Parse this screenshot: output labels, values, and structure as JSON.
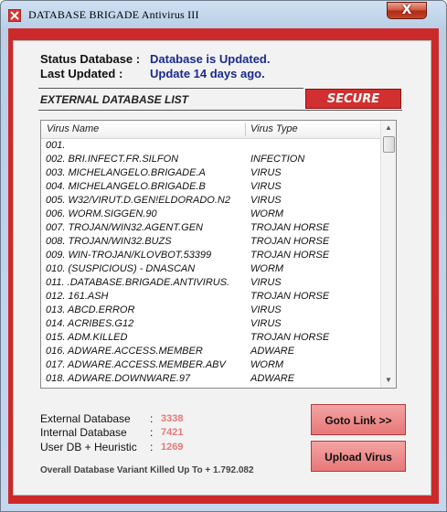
{
  "window": {
    "title": "DATABASE BRIGADE Antivirus III",
    "close_label": "X",
    "colors": {
      "frame": "#cc2a2a",
      "status_value": "#1a2a8c",
      "stat_value": "#e87878",
      "secure_bg": "#d23030"
    }
  },
  "status": {
    "database_label": "Status Database  :",
    "database_value": "Database is Updated.",
    "updated_label": "Last Updated      :",
    "updated_value": "Update 14 days ago."
  },
  "list": {
    "heading": "EXTERNAL DATABASE LIST",
    "secure_label": "SECURE",
    "columns": [
      "Virus Name",
      "Virus Type"
    ],
    "rows": [
      [
        "001.",
        ""
      ],
      [
        "002.  BRI.INFECT.FR.SILFON",
        "INFECTION"
      ],
      [
        "003.  MICHELANGELO.BRIGADE.A",
        "VIRUS"
      ],
      [
        "004.  MICHELANGELO.BRIGADE.B",
        "VIRUS"
      ],
      [
        "005.  W32/VIRUT.D.GEN!ELDORADO.N2",
        "VIRUS"
      ],
      [
        "006.  WORM.SIGGEN.90",
        "WORM"
      ],
      [
        "007. TROJAN/WIN32.AGENT.GEN",
        "TROJAN HORSE"
      ],
      [
        "008. TROJAN/WIN32.BUZS",
        "TROJAN HORSE"
      ],
      [
        "009. WIN-TROJAN/KLOVBOT.53399",
        "TROJAN HORSE"
      ],
      [
        "010. (SUSPICIOUS) - DNASCAN",
        "WORM"
      ],
      [
        "011. .DATABASE.BRIGADE.ANTIVIRUS.",
        "VIRUS"
      ],
      [
        "012. 161.ASH",
        "TROJAN HORSE"
      ],
      [
        "013. ABCD.ERROR",
        "VIRUS"
      ],
      [
        "014. ACRIBES.G12",
        "VIRUS"
      ],
      [
        "015. ADM.KILLED",
        "TROJAN HORSE"
      ],
      [
        "016. ADWARE.ACCESS.MEMBER",
        "ADWARE"
      ],
      [
        "017. ADWARE.ACCESS.MEMBER.ABV",
        "WORM"
      ],
      [
        "018. ADWARE.DOWNWARE.97",
        "ADWARE"
      ]
    ]
  },
  "stats": {
    "external_label": "External Database",
    "external_value": "3338",
    "internal_label": "Internal Database",
    "internal_value": "7421",
    "user_label": "User DB + Heuristic",
    "user_value": "1269",
    "colon": ":",
    "overall": "Overall Database Variant Killed Up To  + 1.792.082"
  },
  "buttons": {
    "goto_link": "Goto Link >>",
    "upload_virus": "Upload Virus"
  }
}
